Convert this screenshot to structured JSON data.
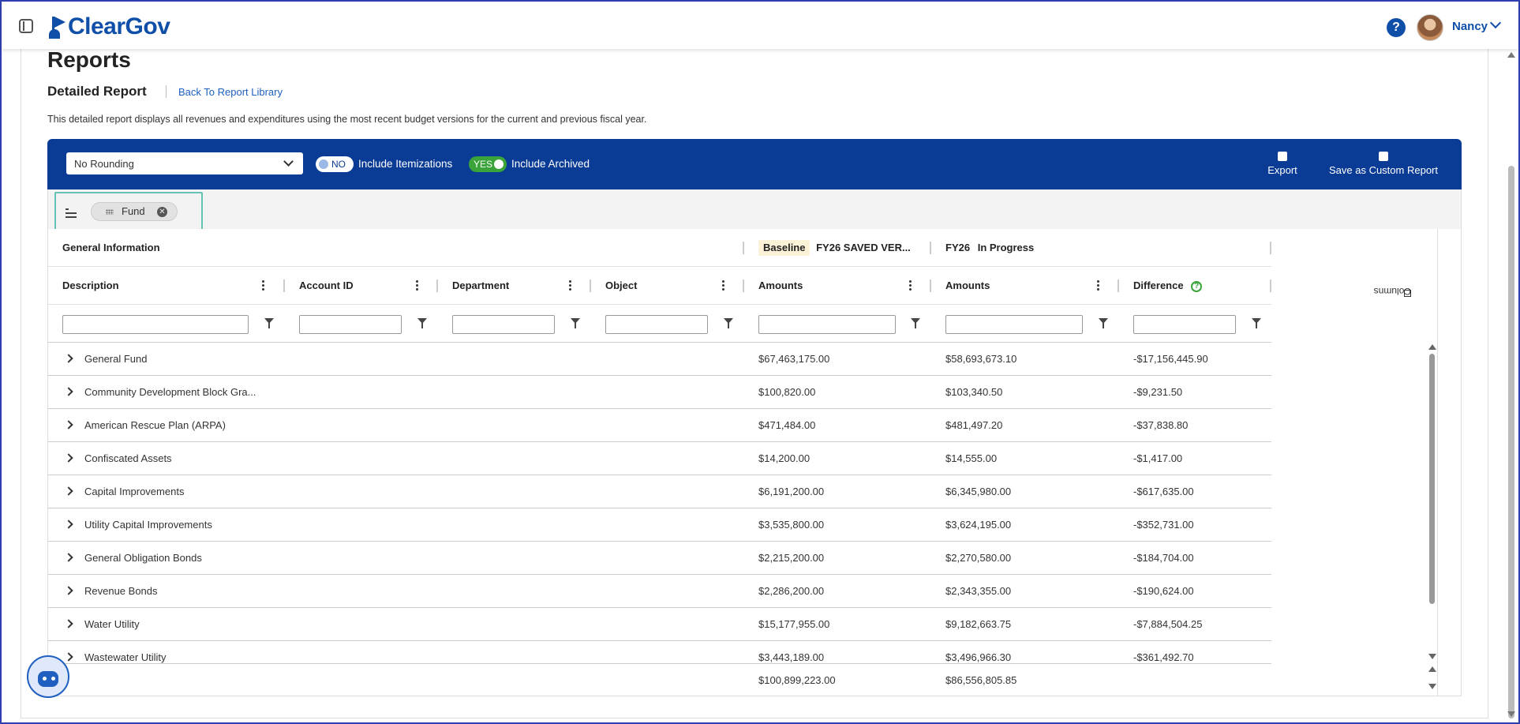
{
  "header": {
    "logo_text": "ClearGov",
    "help_label": "?",
    "user_name": "Nancy"
  },
  "page": {
    "title": "Reports",
    "subtitle": "Detailed Report",
    "back_link": "Back To Report Library",
    "description": "This detailed report displays all revenues and expenditures using the most recent budget versions for the current and previous fiscal year."
  },
  "toolbar": {
    "rounding_value": "No Rounding",
    "itemizations_toggle": "NO",
    "itemizations_label": "Include Itemizations",
    "archived_toggle": "YES",
    "archived_label": "Include Archived",
    "export_label": "Export",
    "save_label": "Save as Custom Report"
  },
  "grouping": {
    "chip_label": "Fund"
  },
  "grid": {
    "group_headers": {
      "general": "General Information",
      "baseline_tag": "Baseline",
      "baseline_rest": "FY26  SAVED VER...",
      "current_fy": "FY26",
      "current_status": "In Progress"
    },
    "columns": [
      "Description",
      "Account ID",
      "Department",
      "Object",
      "Amounts",
      "Amounts",
      "Difference"
    ],
    "rows": [
      {
        "desc": "General Fund",
        "base": "$67,463,175.00",
        "cur": "$58,693,673.10",
        "diff": "-$17,156,445.90"
      },
      {
        "desc": "Community Development Block Gra...",
        "base": "$100,820.00",
        "cur": "$103,340.50",
        "diff": "-$9,231.50"
      },
      {
        "desc": "American Rescue Plan (ARPA)",
        "base": "$471,484.00",
        "cur": "$481,497.20",
        "diff": "-$37,838.80"
      },
      {
        "desc": "Confiscated Assets",
        "base": "$14,200.00",
        "cur": "$14,555.00",
        "diff": "-$1,417.00"
      },
      {
        "desc": "Capital Improvements",
        "base": "$6,191,200.00",
        "cur": "$6,345,980.00",
        "diff": "-$617,635.00"
      },
      {
        "desc": "Utility Capital Improvements",
        "base": "$3,535,800.00",
        "cur": "$3,624,195.00",
        "diff": "-$352,731.00"
      },
      {
        "desc": "General Obligation Bonds",
        "base": "$2,215,200.00",
        "cur": "$2,270,580.00",
        "diff": "-$184,704.00"
      },
      {
        "desc": "Revenue Bonds",
        "base": "$2,286,200.00",
        "cur": "$2,343,355.00",
        "diff": "-$190,624.00"
      },
      {
        "desc": "Water Utility",
        "base": "$15,177,955.00",
        "cur": "$9,182,663.75",
        "diff": "-$7,884,504.25"
      },
      {
        "desc": "Wastewater Utility",
        "base": "$3,443,189.00",
        "cur": "$3,496,966.30",
        "diff": "-$361,492.70"
      }
    ],
    "totals": {
      "base": "$100,899,223.00",
      "cur": "$86,556,805.85"
    },
    "columns_panel_label": "Columns"
  }
}
